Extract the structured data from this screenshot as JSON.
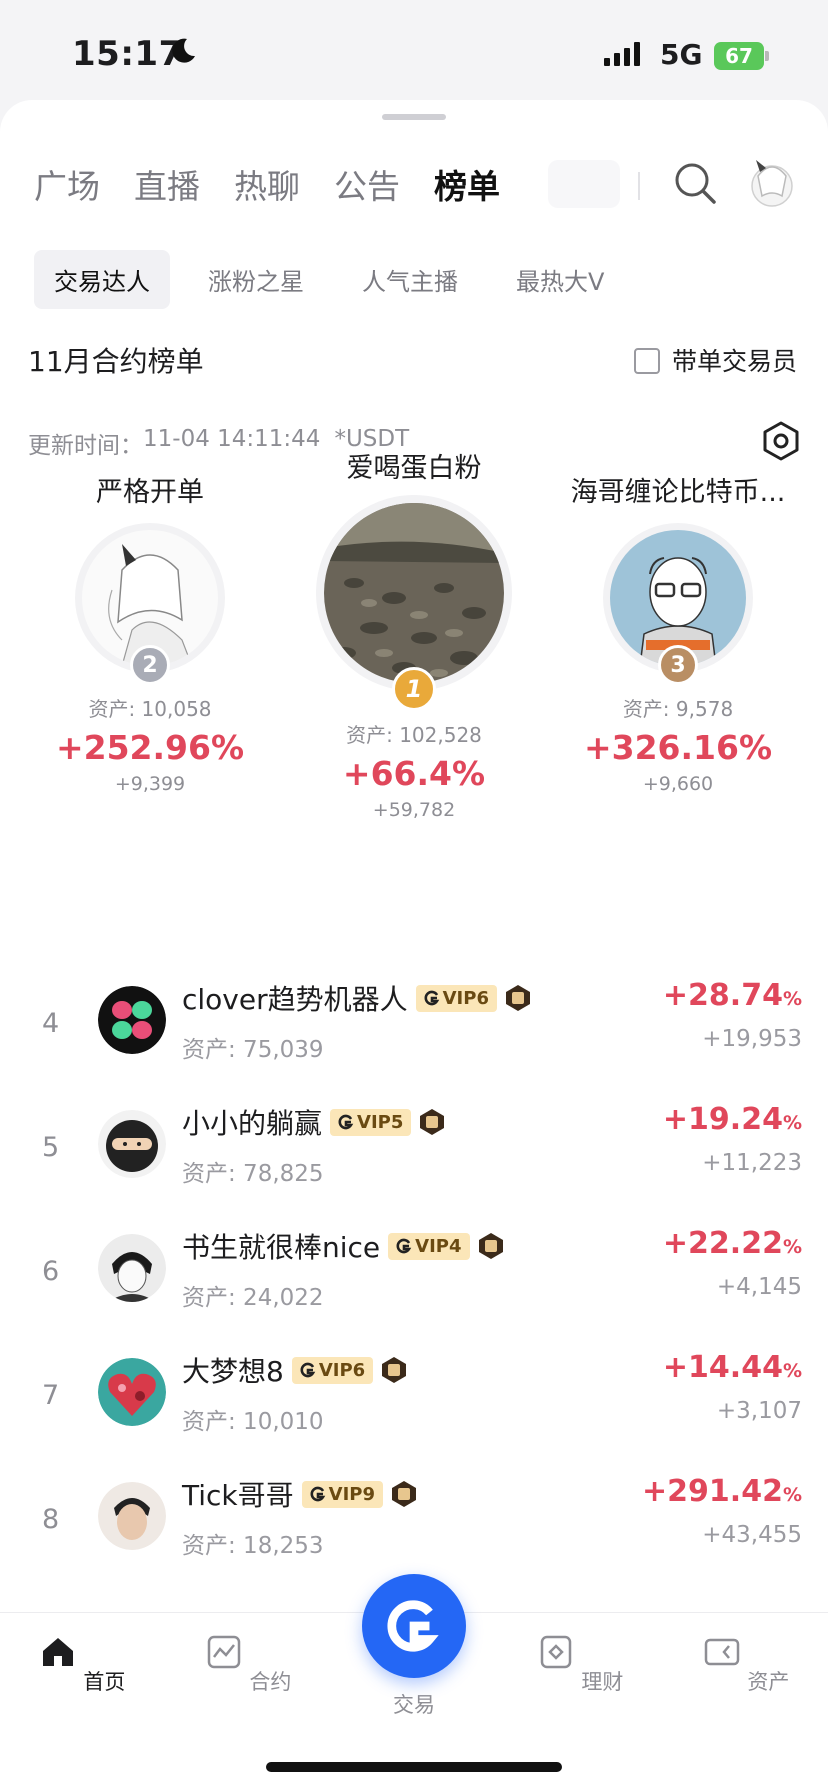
{
  "status_bar": {
    "time": "15:17",
    "network": "5G",
    "battery": "67"
  },
  "tabs": [
    {
      "label": "广场",
      "active": false
    },
    {
      "label": "直播",
      "active": false
    },
    {
      "label": "热聊",
      "active": false
    },
    {
      "label": "公告",
      "active": false
    },
    {
      "label": "榜单",
      "active": true
    }
  ],
  "subtabs": [
    {
      "label": "交易达人",
      "active": true
    },
    {
      "label": "涨粉之星",
      "active": false
    },
    {
      "label": "人气主播",
      "active": false
    },
    {
      "label": "最热大V",
      "active": false
    }
  ],
  "board": {
    "title": "11月合约榜单",
    "filter_label": "带单交易员",
    "update_label": "更新时间：",
    "update_time": "11-04 14:11:44",
    "currency": "*USDT"
  },
  "podium": {
    "first": {
      "rank": "1",
      "name": "爱喝蛋白粉",
      "asset": "资产: 102,528",
      "pct": "+66.4%",
      "gain": "+59,782"
    },
    "second": {
      "rank": "2",
      "name": "严格开单",
      "asset": "资产: 10,058",
      "pct": "+252.96%",
      "gain": "+9,399"
    },
    "third": {
      "rank": "3",
      "name": "海哥缠论比特币...",
      "asset": "资产: 9,578",
      "pct": "+326.16%",
      "gain": "+9,660"
    }
  },
  "rows": [
    {
      "rank": "4",
      "name": "clover趋势机器人",
      "vip": "VIP6",
      "asset": "资产: 75,039",
      "pct": "+28.74",
      "unit": "%",
      "gain": "+19,953"
    },
    {
      "rank": "5",
      "name": "小小的躺赢",
      "vip": "VIP5",
      "asset": "资产: 78,825",
      "pct": "+19.24",
      "unit": "%",
      "gain": "+11,223"
    },
    {
      "rank": "6",
      "name": "书生就很棒nice",
      "vip": "VIP4",
      "asset": "资产: 24,022",
      "pct": "+22.22",
      "unit": "%",
      "gain": "+4,145"
    },
    {
      "rank": "7",
      "name": "大梦想8",
      "vip": "VIP6",
      "asset": "资产: 10,010",
      "pct": "+14.44",
      "unit": "%",
      "gain": "+3,107"
    },
    {
      "rank": "8",
      "name": "Tick哥哥",
      "vip": "VIP9",
      "asset": "资产: 18,253",
      "pct": "+291.42",
      "unit": "%",
      "gain": "+43,455"
    }
  ],
  "nav": [
    {
      "label": "首页",
      "icon": "home-icon",
      "active": true
    },
    {
      "label": "合约",
      "icon": "chart-icon",
      "active": false
    },
    {
      "label": "交易",
      "icon": "gate-logo-icon",
      "active": false
    },
    {
      "label": "理财",
      "icon": "wallet-icon",
      "active": false
    },
    {
      "label": "资产",
      "icon": "assets-icon",
      "active": false
    }
  ],
  "colors": {
    "accent_red": "#e0475b",
    "brand_blue": "#2467f5",
    "vip_gold": "#fbe6b8"
  }
}
